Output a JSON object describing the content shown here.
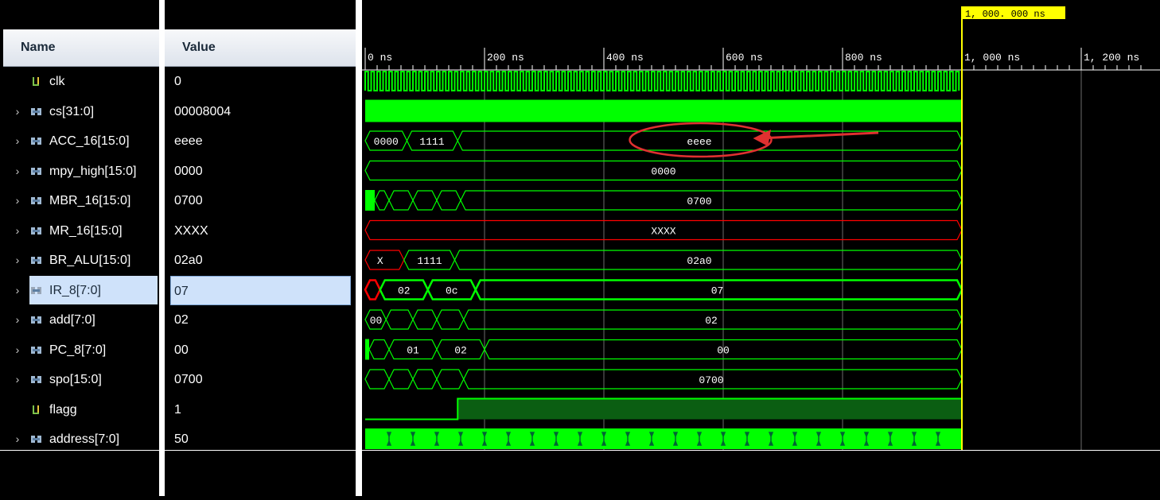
{
  "columns": {
    "name": "Name",
    "value": "Value"
  },
  "time_axis": {
    "ticks": [
      "0 ns",
      "200 ns",
      "400 ns",
      "600 ns",
      "800 ns",
      "1, 000 ns",
      "1, 200 ns"
    ],
    "cursor_label": "1, 000. 000 ns"
  },
  "signals": [
    {
      "name": "clk",
      "value": "0",
      "icon": "bit-icon",
      "expandable": false
    },
    {
      "name": "cs[31:0]",
      "value": "00008004",
      "icon": "bus-icon",
      "expandable": true
    },
    {
      "name": "ACC_16[15:0]",
      "value": "eeee",
      "icon": "bus-icon",
      "expandable": true
    },
    {
      "name": "mpy_high[15:0]",
      "value": "0000",
      "icon": "bus-icon",
      "expandable": true
    },
    {
      "name": "MBR_16[15:0]",
      "value": "0700",
      "icon": "bus-icon",
      "expandable": true
    },
    {
      "name": "MR_16[15:0]",
      "value": "XXXX",
      "icon": "bus-icon",
      "expandable": true
    },
    {
      "name": "BR_ALU[15:0]",
      "value": "02a0",
      "icon": "bus-icon",
      "expandable": true
    },
    {
      "name": "IR_8[7:0]",
      "value": "07",
      "icon": "bus-icon-selected",
      "expandable": true,
      "selected": true
    },
    {
      "name": "add[7:0]",
      "value": "02",
      "icon": "bus-icon",
      "expandable": true
    },
    {
      "name": "PC_8[7:0]",
      "value": "00",
      "icon": "bus-icon",
      "expandable": true
    },
    {
      "name": "spo[15:0]",
      "value": "0700",
      "icon": "bus-icon",
      "expandable": true
    },
    {
      "name": "flagg",
      "value": "1",
      "icon": "bit-icon",
      "expandable": false
    },
    {
      "name": "address[7:0]",
      "value": "50",
      "icon": "bus-icon",
      "expandable": true
    }
  ],
  "waveform_labels": {
    "acc": [
      "0000",
      "1111",
      "eeee"
    ],
    "mpy_high": [
      "0000"
    ],
    "mbr": [
      "0700"
    ],
    "mr": [
      "XXXX"
    ],
    "br_alu": [
      "X",
      "1111",
      "02a0"
    ],
    "ir": [
      "02",
      "0c",
      "07"
    ],
    "add": [
      "00",
      "02"
    ],
    "pc": [
      "01",
      "02",
      "00"
    ],
    "spo": [
      "0700"
    ]
  },
  "colors": {
    "wave": "#00ff00",
    "unknown": "#ff0000",
    "cursor": "#ffff00",
    "annotation": "#e03030",
    "background": "#000000",
    "grid": "#6b6b6b"
  }
}
